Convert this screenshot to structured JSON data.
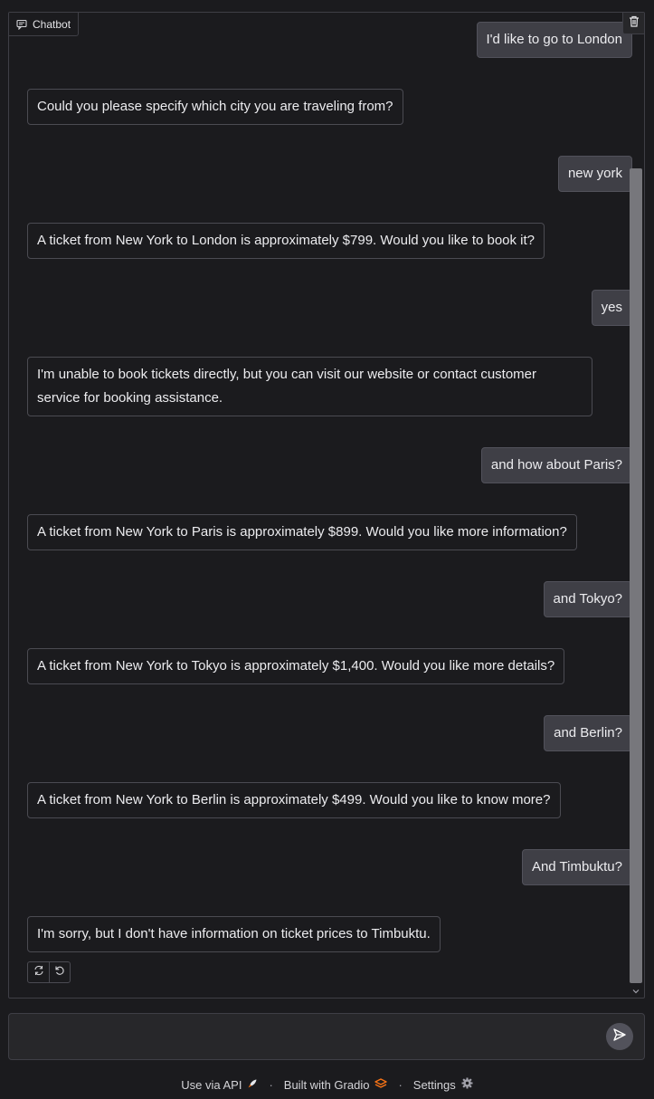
{
  "chatbot": {
    "label": "Chatbot",
    "label_icon": "chat-icon",
    "clear_icon": "trash-icon",
    "messages": [
      {
        "role": "user",
        "text": "I'd like to go to London"
      },
      {
        "role": "bot",
        "text": "Could you please specify which city you are traveling from?"
      },
      {
        "role": "user",
        "text": "new york"
      },
      {
        "role": "bot",
        "text": "A ticket from New York to London is approximately $799. Would you like to book it?"
      },
      {
        "role": "user",
        "text": "yes"
      },
      {
        "role": "bot",
        "text": "I'm unable to book tickets directly, but you can visit our website or contact customer service for booking assistance."
      },
      {
        "role": "user",
        "text": "and how about Paris?"
      },
      {
        "role": "bot",
        "text": "A ticket from New York to Paris is approximately $899. Would you like more information?"
      },
      {
        "role": "user",
        "text": "and Tokyo?"
      },
      {
        "role": "bot",
        "text": "A ticket from New York to Tokyo is approximately $1,400. Would you like more details?"
      },
      {
        "role": "user",
        "text": "and Berlin?"
      },
      {
        "role": "bot",
        "text": "A ticket from New York to Berlin is approximately $499. Would you like to know more?"
      },
      {
        "role": "user",
        "text": "And Timbuktu?"
      },
      {
        "role": "bot",
        "text": "I'm sorry, but I don't have information on ticket prices to Timbuktu."
      }
    ],
    "actions": [
      "retry-icon",
      "undo-icon"
    ]
  },
  "input": {
    "value": "",
    "placeholder": "",
    "send_icon": "send-icon"
  },
  "footer": {
    "api_label": "Use via API",
    "gradio_label": "Built with Gradio",
    "settings_label": "Settings"
  },
  "colors": {
    "background": "#1b1b1e",
    "user_bubble": "#3f3f46",
    "border": "#3f3f46",
    "accent": "#f97316"
  }
}
